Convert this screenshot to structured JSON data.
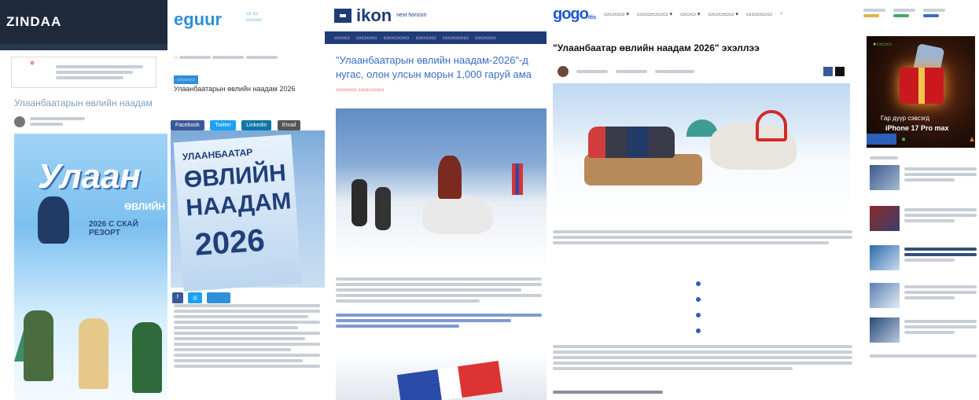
{
  "panel_zindaa": {
    "logo": "ZINDAA",
    "title": "Улаанбаатарын өвлийн наадам",
    "poster": {
      "word": "Улаан",
      "sub": "ӨВЛИЙН",
      "date": "2026 С СКАЙ РЕЗОРТ"
    }
  },
  "panel_egoor": {
    "logo": "eguur",
    "title": "Улаанбаатарын өвлийн наадам 2026",
    "share_buttons": [
      "Facebook",
      "Twitter",
      "Linkedin",
      "Email"
    ],
    "banner": {
      "line1": "УЛААНБААТАР",
      "line2": "ӨВЛИЙН",
      "line3": "НААДАМ",
      "line4": "2026"
    }
  },
  "panel_ikon": {
    "logo": "ikon",
    "logo_sub": "next horizon",
    "title_line1": "\"Улаанбаатарын өвлийн наадам-2026\"-д",
    "title_line2": "нугас, олон улсын морьн 1,000 гаруй ама"
  },
  "panel_gogo": {
    "logo": "gogo",
    "logo_sub": "itis",
    "title": "\"Улаанбаатар өвлийн наадам 2026\" эхэллээ"
  },
  "sidebar": {
    "ad_line1": "Гар дүүр сэвсэгд",
    "ad_line2": "iPhone 17 Pro max"
  },
  "colors": {
    "gogo_blue": "#1e56d6",
    "ikon_navy": "#1f3b78",
    "egoor_blue": "#2f8fd8",
    "zindaa_dark": "#1e2a3c"
  }
}
